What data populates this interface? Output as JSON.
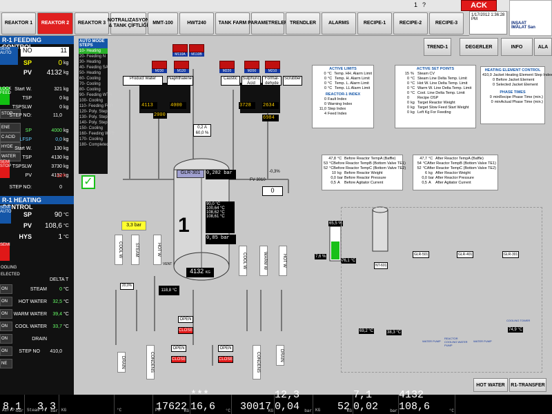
{
  "title_bar": {
    "left_text": "",
    "page_number": "1",
    "help": "?"
  },
  "ack": "ACK",
  "clock": "1/17/2012 1:36:28 PM",
  "logo": {
    "line1": "INŞAAT",
    "line2": "İMALAT San"
  },
  "tabs": [
    "REAKTOR 1",
    "REAKTOR 2",
    "REAKTOR 3",
    "NOTRALIZASYON & TANK ÇİFTLİĞİ",
    "MMT-100",
    "HWT240",
    "TANK FARM",
    "PARAMETRELER",
    "TRENDLER",
    "ALARMS",
    "RECIPE-1",
    "RECIPE-2",
    "RECIPE-3"
  ],
  "right_buttons": [
    "TREND-1",
    "DEGERLER",
    "INFO",
    "ALA"
  ],
  "left": {
    "feeding_header": "R-1 FEEDING CONTROL",
    "no_label": "NO",
    "no_value": "11",
    "sp_label": "SP",
    "sp_value": "0",
    "sp_unit": "kg",
    "pv_label": "PV",
    "pv_value": "4132",
    "pv_unit": "kg",
    "start_w_label": "Start W.",
    "start_w": "321",
    "start_w_unit": "kg",
    "tsp_label": "TSP",
    "tsp": "0",
    "tsp_unit": "kg",
    "tspslw_label": "TSPSLW",
    "tspslw": "0",
    "tspslw_unit": "kg",
    "stepno_label": "STEP NO:",
    "stepno": "11,0",
    "sp2_label": "SP",
    "sp2": "4000",
    "sp2_unit": "kg",
    "lfsp_label": "LFSP",
    "lfsp": "0,0",
    "lfsp_unit": "kg",
    "start_w2_label": "Start W.",
    "start_w2": "130",
    "start_w2_unit": "kg",
    "tsp2_label": "TSP",
    "tsp2": "4130",
    "tsp2_unit": "kg",
    "tspslw2_label": "TSPSLW",
    "tspslw2": "3730",
    "tspslw2_unit": "kg",
    "pv2_label": "PV",
    "pv2": "4132",
    "pv2_unit": "kg",
    "stepno2_label": "STEP NO:",
    "stepno2": "0",
    "off": "OFF",
    "side_labels": [
      "SEMI AUTO",
      "LOCK FEED",
      "STOP",
      "ENE",
      "C ACID",
      "HYDE",
      "WATER",
      "SEMI STOP"
    ],
    "heating_header": "R-1 HEATING CONTROL",
    "h_sp_label": "SP",
    "h_sp": "90",
    "h_sp_unit": "°C",
    "h_pv_label": "PV",
    "h_pv": "108,6",
    "h_pv_unit": "°C",
    "h_hys_label": "HYS",
    "h_hys": "1",
    "h_hys_unit": "°C",
    "delta_t": "DELTA T",
    "steam_label": "STEAM",
    "steam": "0",
    "steam_unit": "°C",
    "hotwater_label": "HOT WATER",
    "hotwater": "32,5",
    "hotwater_unit": "°C",
    "warmwater_label": "WARM WATER",
    "warmwater": "39,4",
    "warmwater_unit": "°C",
    "coolwater_label": "COOL WATER",
    "coolwater": "33,7",
    "coolwater_unit": "°C",
    "drain_label": "DRAIN",
    "stepno3_label": "STEP NO",
    "stepno3": "410,0",
    "h_side": [
      "SEMI AUTO",
      "SEMI",
      "OOLING",
      "ELECTED",
      "ON",
      "ON",
      "ON",
      "ON",
      "ON",
      "ON",
      "NE"
    ]
  },
  "steps": {
    "header": "AUTO MODE STEPS",
    "items": [
      "10- Heating",
      "20- Feeding N",
      "30- Heating",
      "40- Feeding SA",
      "50- Heating",
      "60- Cooling",
      "70- Cooling",
      "80- Cooling",
      "90- Feeding WTR",
      "100- Cooling",
      "110- Feeding FOR",
      "120- Poly. Step1",
      "130- Poly. Step2",
      "140- Poly. Step3",
      "150- Cooling",
      "160- Feeding WTR",
      "170- Cooling",
      "180- Completed"
    ],
    "active_index": 0
  },
  "process": {
    "motors_top": [
      "M110A",
      "M110B",
      "M230",
      "M120",
      "M220",
      "M200",
      "M210"
    ],
    "tank_labels": [
      "Product Water",
      "Naphthalene",
      "Caustic",
      "Sulphuric Acid",
      "Formal-dehyde",
      "Scrubber"
    ],
    "tank_values": [
      "4113",
      "2000",
      "4000",
      "3728",
      "2634",
      "6984"
    ],
    "sp_label": "sp",
    "agitator_a": "0,2 A",
    "agitator_pct": "60,0 %",
    "reactor_id": "GLR-301",
    "reactor_num": "1",
    "reactor_kg": "4132",
    "reactor_kg_unit": "KG",
    "weight_box": "0,282 bar",
    "pressure_box": "0,85 bar",
    "temps": [
      "90,0 °C",
      "100,64 °C",
      "108,62 °C",
      "108,61 °C"
    ],
    "bar_box": "3,3 bar",
    "fv_label": "FV 3010",
    "fv_pct": "-0,3%",
    "fv_value": "0",
    "temp_118": "118,8 °C",
    "vertical_pipes": [
      "COOL W",
      "STEAM",
      "HOT W",
      "COOL W",
      "WARM W",
      "HOT W"
    ],
    "valve_20": "20,0%",
    "open": "OPEN",
    "close": "CLOSE",
    "drain": "DRAIN",
    "condens": "CONDENS",
    "vent": "VENT",
    "level_pct": "65,5 %",
    "level_76": "7,6 %",
    "temp_76": "76,1 °C",
    "mini_tanks": [
      "NT-601",
      "GLR-501",
      "GLR-401",
      "GLR-301"
    ],
    "mini_val1": "69,2 °C",
    "mini_val2": "38,3 °C",
    "mini_val3": "74,9 °C",
    "mini_lbls": [
      "WATER PUMP",
      "REACTOR COOLING WATER PUMP",
      "WATER PUMP",
      "COOLING TOWER"
    ]
  },
  "active_limits": {
    "header": "ACTIVE LIMITS",
    "rows": [
      [
        "0",
        "°C",
        "Temp. HH. Alarm Limit"
      ],
      [
        "0",
        "°C",
        "Temp. H. Alarm Limit"
      ],
      [
        "0",
        "°C",
        "Temp. L. Alarm Limit"
      ],
      [
        "0",
        "°C",
        "Temp. LL Alarm Limit"
      ]
    ],
    "index_header": "REACTOR-1 INDEX",
    "index_rows": [
      [
        "0",
        "Fault Index"
      ],
      [
        "0",
        "Warning Index"
      ],
      [
        "11,0",
        "Step Index"
      ],
      [
        "4",
        "Feed Index"
      ]
    ]
  },
  "active_sp": {
    "header": "ACTIVE SET POINTS",
    "rows": [
      [
        "15",
        "%",
        "Steam CV"
      ],
      [
        "0",
        "°C",
        "Steam Line Delta Temp. Limit"
      ],
      [
        "0",
        "°C",
        "Hot W. Line Delta Temp. Limit"
      ],
      [
        "0",
        "°C",
        "Warm W. Line Delta Temp. Limit"
      ],
      [
        "0",
        "°C",
        "Cool. Line Delta Temp. Limit"
      ],
      [
        "0",
        "",
        "Recipe OSP"
      ],
      [
        "0",
        "kg",
        "Target Reactor Weight"
      ],
      [
        "0",
        "kg",
        "Target Slow Feed Start Weight"
      ],
      [
        "0",
        "kg",
        "Left Kg For Feeding"
      ]
    ]
  },
  "heating_element": {
    "header": "HEATING ELEMENT CONTROL",
    "rows": [
      [
        "410,0",
        "Jacket Heating Element Step Index"
      ],
      [
        "0",
        "Before Jacket Element"
      ],
      [
        "0",
        "Selected Jacket Element"
      ]
    ],
    "phase_header": "PHASE TIMES",
    "phase_rows": [
      [
        "0",
        "min",
        "Recipe Phase Time (min.)"
      ],
      [
        "0",
        "min",
        "Actual Phase Time (min.)"
      ]
    ]
  },
  "before_panel": {
    "rows": [
      [
        "47,8",
        "°C",
        "Before Reactor TempA (Baffle)"
      ],
      [
        "53",
        "°C",
        "Before Reactor TempB (Bottom Valve TE1)"
      ],
      [
        "52",
        "°C",
        "Before Reactor TempC (Bottom Valve TE2)"
      ],
      [
        "10",
        "kg",
        "Before Reactor Weight"
      ],
      [
        "0,0",
        "bar",
        "Before Reactor Pressure"
      ],
      [
        "0,5",
        "A",
        "Before Agitator Current"
      ]
    ]
  },
  "after_panel": {
    "rows": [
      [
        "47,7",
        "°C",
        "After Reactor TempA (Baffle)"
      ],
      [
        "54",
        "°C",
        "After Reactor TempB (Bottom Valve TE1)"
      ],
      [
        "52",
        "°C",
        "After Reactor TempC (Bottom Valve TE2)"
      ],
      [
        "6",
        "kg",
        "After Reactor Weight"
      ],
      [
        "0,0",
        "bar",
        "After Reactor Pressure"
      ],
      [
        "0,5",
        "A",
        "After Agitator Current"
      ]
    ]
  },
  "bottom_buttons": [
    "HOT WATER",
    "R1-TRANSFER"
  ],
  "bottom_bar": [
    {
      "small": "Air P.",
      "big": "8,1",
      "unit": "bar"
    },
    {
      "small": "Steam P.",
      "big": "3,3",
      "unit": "bar"
    },
    {
      "small": "KG",
      "big": "",
      "unit": ""
    },
    {
      "small": "°C",
      "big": "",
      "unit": ""
    },
    {
      "small": "PH",
      "big": "17622",
      "unit": "KG"
    },
    {
      "small": "",
      "big": "*** 16,6",
      "unit": "°C"
    },
    {
      "small": "",
      "big": "30017",
      "unit": "KG"
    },
    {
      "small": "",
      "big": "12,3 0,04",
      "unit": "bar"
    },
    {
      "small": "KG",
      "big": "52",
      "unit": "KG"
    },
    {
      "small": "",
      "big": "7,1 0,02",
      "unit": "bar"
    },
    {
      "small": "",
      "big": "4132 108,6",
      "unit": "°C"
    }
  ]
}
